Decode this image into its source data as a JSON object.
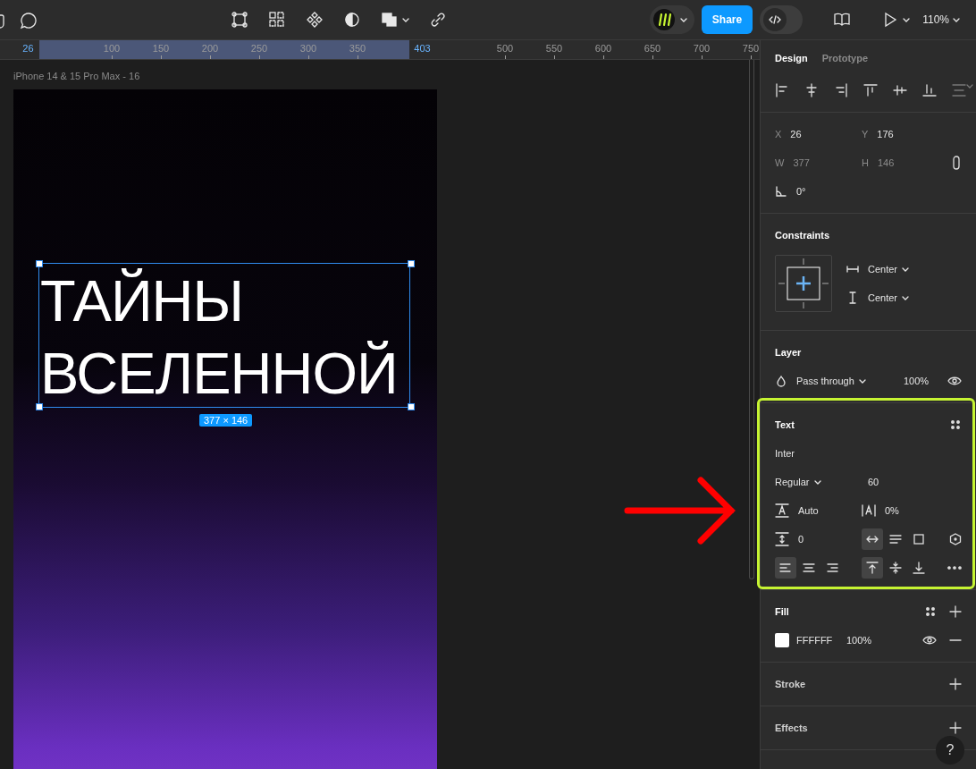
{
  "toolbar": {
    "share_button": "Share",
    "dev_mode": {
      "on": false
    },
    "zoom": "110%"
  },
  "ruler": {
    "ticks": [
      {
        "label": "26",
        "kind": "selection-start"
      },
      {
        "label": "100",
        "kind": "tick"
      },
      {
        "label": "150",
        "kind": "tick"
      },
      {
        "label": "200",
        "kind": "tick"
      },
      {
        "label": "250",
        "kind": "tick"
      },
      {
        "label": "300",
        "kind": "tick"
      },
      {
        "label": "350",
        "kind": "tick"
      },
      {
        "label": "403",
        "kind": "selection-end"
      },
      {
        "label": "500",
        "kind": "tick"
      },
      {
        "label": "550",
        "kind": "tick"
      },
      {
        "label": "600",
        "kind": "tick"
      },
      {
        "label": "650",
        "kind": "tick"
      },
      {
        "label": "700",
        "kind": "tick"
      },
      {
        "label": "750",
        "kind": "tick"
      }
    ]
  },
  "canvas": {
    "frame_label": "iPhone 14 & 15 Pro Max - 16",
    "text_lines": [
      "ТАЙНЫ",
      "ВСЕЛЕННОЙ"
    ],
    "size_badge": "377 × 146"
  },
  "panel": {
    "tabs": [
      {
        "label": "Design",
        "selected": true
      },
      {
        "label": "Prototype",
        "selected": false
      }
    ],
    "position": {
      "fields": [
        {
          "label": "X",
          "value": "26",
          "disabled": false
        },
        {
          "label": "Y",
          "value": "176",
          "disabled": false
        },
        {
          "label": "W",
          "value": "377",
          "disabled": true
        },
        {
          "label": "H",
          "value": "146",
          "disabled": true
        }
      ],
      "rotation": "0°"
    },
    "constraints": {
      "title": "Constraints",
      "horizontal": "Center",
      "vertical": "Center"
    },
    "layer": {
      "title": "Layer",
      "blend_mode": "Pass through",
      "opacity": "100%"
    },
    "text": {
      "title": "Text",
      "font_family": "Inter",
      "font_weight": "Regular",
      "font_size": "60",
      "line_height": "Auto",
      "letter_spacing": "0%",
      "paragraph_spacing": "0",
      "resizing": [
        {
          "kind": "auto-width",
          "selected": true
        },
        {
          "kind": "auto-height",
          "selected": false
        },
        {
          "kind": "fixed-size",
          "selected": false
        }
      ],
      "horizontal_align": [
        {
          "kind": "left",
          "selected": true
        },
        {
          "kind": "center",
          "selected": false
        },
        {
          "kind": "right",
          "selected": false
        }
      ],
      "vertical_align": [
        {
          "kind": "top",
          "selected": true
        },
        {
          "kind": "middle",
          "selected": false
        },
        {
          "kind": "bottom",
          "selected": false
        }
      ]
    },
    "fill": {
      "title": "Fill",
      "fills": [
        {
          "hex": "FFFFFF",
          "opacity": "100%",
          "color": "#ffffff"
        }
      ]
    },
    "stroke": {
      "title": "Stroke"
    },
    "effects": {
      "title": "Effects"
    },
    "help_button": "?"
  }
}
